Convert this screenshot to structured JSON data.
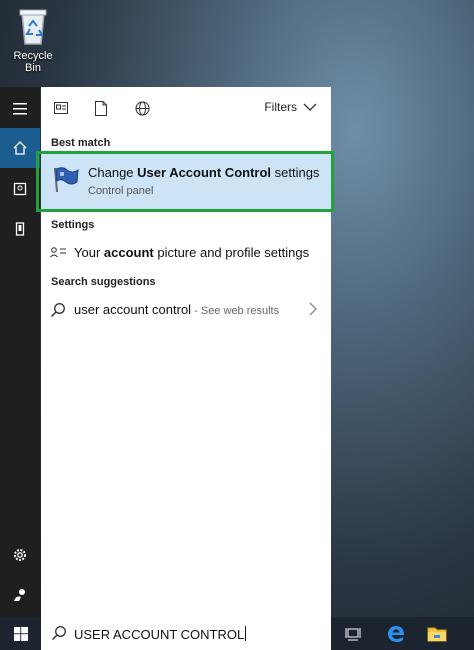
{
  "desktop": {
    "recycle_bin_label": "Recycle Bin"
  },
  "toolbar": {
    "filters_label": "Filters"
  },
  "sections": {
    "best_match": "Best match",
    "settings": "Settings",
    "search_suggestions": "Search suggestions"
  },
  "best_match": {
    "title_pre": "Change ",
    "title_bold": "User Account Control",
    "title_post": " settings",
    "subtitle": "Control panel"
  },
  "settings_item": {
    "pre": "Your ",
    "bold": "account",
    "post": " picture and profile settings"
  },
  "suggestion": {
    "query": "user account control",
    "suffix": " - See web results"
  },
  "search": {
    "query": "USER ACCOUNT CONTROL"
  },
  "colors": {
    "accent": "#1b5d8e",
    "highlight": "#cde4f7",
    "outline": "#23a13a"
  }
}
